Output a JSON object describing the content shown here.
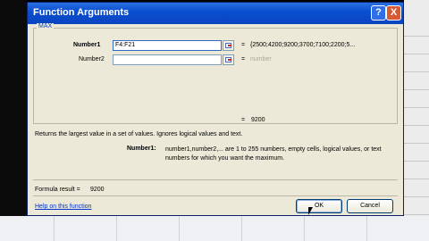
{
  "dialog": {
    "title": "Function Arguments",
    "help_button": "?",
    "close_button": "X",
    "function_name": "MAX",
    "arguments": [
      {
        "label": "Number1",
        "value": "F4:F21",
        "equals": "=",
        "preview": "{2500;4200;9200;3700;7100;2200;5...",
        "preview_gray": false
      },
      {
        "label": "Number2",
        "value": "",
        "equals": "=",
        "preview": "number",
        "preview_gray": true
      }
    ],
    "result_equals": "=",
    "result_preview": "9200",
    "description": "Returns the largest value in a set of values. Ignores logical values and text.",
    "arg_help_name": "Number1:",
    "arg_help_text": "number1,number2,... are 1 to 255 numbers, empty cells, logical values, or text numbers for which you want the maximum.",
    "formula_result_label": "Formula result =",
    "formula_result_value": "9200",
    "help_link": "Help on this function",
    "ok_label": "OK",
    "cancel_label": "Cancel"
  },
  "colors": {
    "titlebar": "#0a44c0",
    "dialog_bg": "#ece9d8",
    "link": "#0033cc"
  }
}
